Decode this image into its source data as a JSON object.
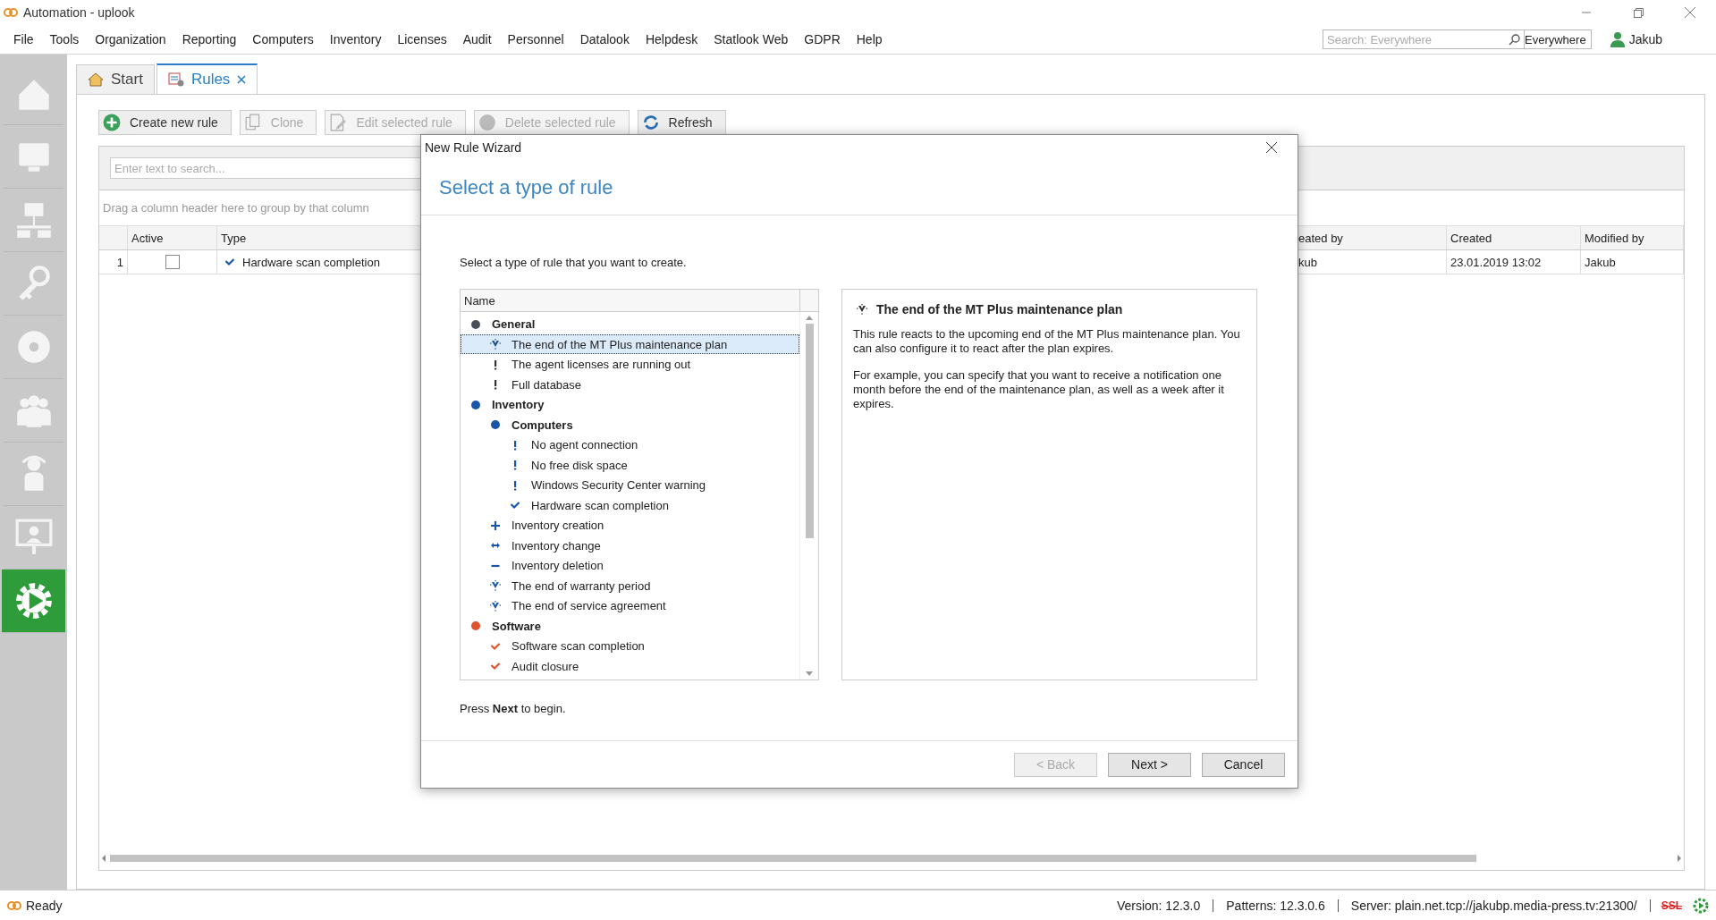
{
  "window": {
    "title": "Automation - uplook"
  },
  "menu": [
    "File",
    "Tools",
    "Organization",
    "Reporting",
    "Computers",
    "Inventory",
    "Licenses",
    "Audit",
    "Personnel",
    "Datalook",
    "Helpdesk",
    "Statlook Web",
    "GDPR",
    "Help"
  ],
  "search": {
    "placeholder": "Search: Everywhere",
    "scope": "Everywhere"
  },
  "user": "Jakub",
  "sidebar": [
    {
      "selected": false
    },
    {
      "selected": false
    },
    {
      "selected": false
    },
    {
      "selected": false
    },
    {
      "selected": false
    },
    {
      "selected": false
    },
    {
      "selected": false
    },
    {
      "selected": false
    },
    {
      "selected": true
    }
  ],
  "tabs": [
    {
      "label": "Start",
      "selected": false,
      "closable": false
    },
    {
      "label": "Rules",
      "selected": true,
      "closable": true
    }
  ],
  "toolbar": [
    {
      "label": "Create new rule",
      "disabled": false
    },
    {
      "label": "Clone",
      "disabled": true
    },
    {
      "label": "Edit selected rule",
      "disabled": true
    },
    {
      "label": "Delete selected rule",
      "disabled": true
    },
    {
      "label": "Refresh",
      "disabled": false
    }
  ],
  "grid": {
    "search_placeholder": "Enter text to search...",
    "group_hint": "Drag a column header here to group by that column",
    "columns": [
      "Active",
      "Type",
      "eated by",
      "Created",
      "Modified by"
    ],
    "rows": [
      {
        "number": "1",
        "active": false,
        "type": "Hardware scan completion",
        "column_3": "kub",
        "created": "23.01.2019 13:02",
        "modified_by": "Jakub"
      }
    ]
  },
  "dialog": {
    "title": "New Rule Wizard",
    "heading": "Select a type of rule",
    "instruction": "Select a type of rule that you want to create.",
    "tree_column": "Name",
    "tree": [
      {
        "label": "General",
        "kind": "group",
        "color": "#4a5058",
        "children": [
          {
            "label": "The end of the MT Plus maintenance plan",
            "kind": "expiry",
            "color": "#1f4e8c",
            "selected": true
          },
          {
            "label": "The agent licenses are running out",
            "kind": "warning",
            "color": "#333333",
            "selected": false
          },
          {
            "label": "Full database",
            "kind": "warning",
            "color": "#333333",
            "selected": false
          }
        ]
      },
      {
        "label": "Inventory",
        "kind": "group",
        "color": "#1a56a8",
        "children": [
          {
            "label": "Computers",
            "kind": "group",
            "color": "#1a56a8",
            "children": [
              {
                "label": "No agent connection",
                "kind": "warning",
                "color": "#1a56a8",
                "selected": false
              },
              {
                "label": "No free disk space",
                "kind": "warning",
                "color": "#1a56a8",
                "selected": false
              },
              {
                "label": "Windows Security Center warning",
                "kind": "warning",
                "color": "#1a56a8",
                "selected": false
              },
              {
                "label": "Hardware scan completion",
                "kind": "check",
                "color": "#1a56a8",
                "selected": false
              }
            ]
          },
          {
            "label": "Inventory creation",
            "kind": "plus",
            "color": "#1a56a8",
            "selected": false
          },
          {
            "label": "Inventory change",
            "kind": "swap",
            "color": "#1a56a8",
            "selected": false
          },
          {
            "label": "Inventory deletion",
            "kind": "minus",
            "color": "#1a56a8",
            "selected": false
          },
          {
            "label": "The end of warranty period",
            "kind": "expiry",
            "color": "#1a56a8",
            "selected": false
          },
          {
            "label": "The end of service agreement",
            "kind": "expiry",
            "color": "#1a56a8",
            "selected": false
          }
        ]
      },
      {
        "label": "Software",
        "kind": "group",
        "color": "#e0512e",
        "children": [
          {
            "label": "Software scan completion",
            "kind": "check",
            "color": "#e0512e",
            "selected": false
          },
          {
            "label": "Audit closure",
            "kind": "check",
            "color": "#e0512e",
            "selected": false
          }
        ]
      }
    ],
    "description": {
      "title": "The end of the MT Plus maintenance plan",
      "paragraphs": [
        "This rule reacts to the upcoming end of the MT Plus maintenance plan. You can also configure it to react after the plan expires.",
        "For example, you can specify that you want to receive a notification one month before the end of the maintenance plan, as well as a week after it expires."
      ]
    },
    "hint": "Press **Next** to begin.",
    "buttons": [
      {
        "label": "< Back",
        "disabled": true
      },
      {
        "label": "Next >",
        "disabled": false
      },
      {
        "label": "Cancel",
        "disabled": false
      }
    ]
  },
  "status_bar": {
    "state": "Ready",
    "items": [
      "Version: 12.3.0",
      "Patterns: 12.3.0.6",
      "Server: plain.net.tcp://jakubp.media-press.tv:21300/"
    ],
    "ssl": "SSL"
  }
}
